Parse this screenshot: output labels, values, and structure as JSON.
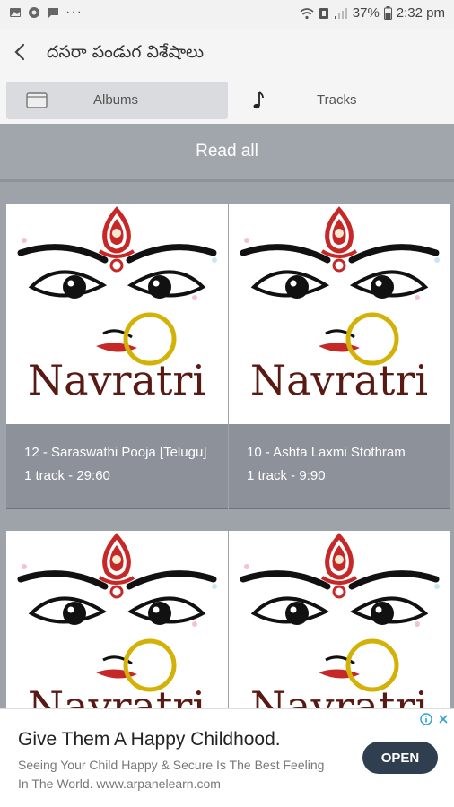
{
  "status_bar": {
    "dots": "···",
    "battery_percent": "37%",
    "time": "2:32 pm",
    "icons": [
      "gallery-icon",
      "chrome-icon",
      "chat-icon",
      "wifi-icon",
      "data-icon",
      "signal-icon",
      "battery-icon"
    ]
  },
  "header": {
    "title": "దసరా పండుగ విశేషాలు",
    "back_icon": "back-arrow-icon"
  },
  "tabs": [
    {
      "label": "Albums",
      "icon": "album-icon",
      "selected": true
    },
    {
      "label": "Tracks",
      "icon": "music-note-icon",
      "selected": false
    }
  ],
  "read_all": {
    "label": "Read all"
  },
  "albums": [
    {
      "title": "12 - Saraswathi Pooja [Telugu]",
      "meta": "1 track - 29:60",
      "art_text": "Navratri"
    },
    {
      "title": "10 - Ashta Laxmi Stothram",
      "meta": "1 track - 9:90",
      "art_text": "Navratri"
    },
    {
      "title": "",
      "meta": "",
      "art_text": "Navratri"
    },
    {
      "title": "",
      "meta": "",
      "art_text": "Navratri"
    }
  ],
  "ad": {
    "title": "Give Them A Happy Childhood.",
    "description": "Seeing Your Child Happy & Secure Is The Best Feeling In The World. www.arpanelearn.com",
    "cta": "OPEN"
  },
  "colors": {
    "content_bg": "#9ea3a9",
    "read_all_bg": "#a1a6ad",
    "card_info_bg": "#8d929a",
    "ad_button": "#2f3f4f",
    "art_red": "#c62828",
    "art_gold": "#d4b106"
  }
}
